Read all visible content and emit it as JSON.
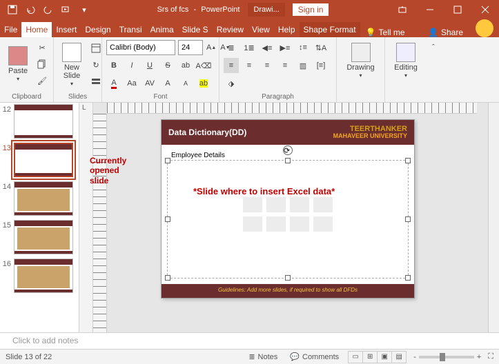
{
  "title": "Srs of fcs",
  "app": "PowerPoint",
  "titlebar": {
    "drawi": "Drawi...",
    "signin": "Sign in"
  },
  "tabs": [
    "File",
    "Home",
    "Insert",
    "Design",
    "Transi",
    "Anima",
    "Slide S",
    "Review",
    "View",
    "Help",
    "Shape Format"
  ],
  "tellme": "Tell me",
  "share": "Share",
  "ribbon": {
    "clipboard": "Clipboard",
    "paste": "Paste",
    "slides": "Slides",
    "newslide": "New Slide",
    "font": "Font",
    "fontname": "Calibri (Body)",
    "fontsize": "24",
    "paragraph": "Paragraph",
    "drawing": "Drawing",
    "editing": "Editing"
  },
  "outline": "L",
  "thumbs": [
    {
      "n": "12"
    },
    {
      "n": "13",
      "current": true
    },
    {
      "n": "14"
    },
    {
      "n": "15"
    },
    {
      "n": "16"
    }
  ],
  "slide": {
    "title": "Data Dictionary(DD)",
    "uni1": "TEERTHANKER",
    "uni2": "MAHAVEER UNIVERSITY",
    "sub": "Employee Details",
    "footer": "Guidelines: Add more slides, if required to show all DFDs"
  },
  "annot": {
    "current": "Currently opened slide",
    "insert": "*Slide where to insert Excel data*"
  },
  "notes": "Click to add notes",
  "status": {
    "slide": "Slide 13 of 22",
    "notes": "Notes",
    "comments": "Comments",
    "zoom_minus": "-",
    "zoom_plus": "+"
  }
}
